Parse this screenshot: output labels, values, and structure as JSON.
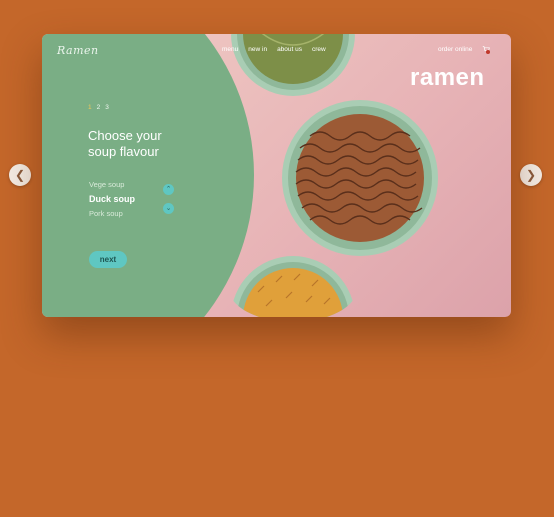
{
  "logo": "Ramen",
  "nav": {
    "items": [
      "menu",
      "new in",
      "about us",
      "crew"
    ]
  },
  "order": "order online",
  "brand": "ramen",
  "steps": {
    "items": [
      "1",
      "2",
      "3"
    ],
    "active": "1"
  },
  "headline": {
    "line1": "Choose your",
    "line2": "soup flavour"
  },
  "soups": {
    "items": [
      "Vege soup",
      "Duck soup",
      "Pork soup"
    ],
    "selected": "Duck soup"
  },
  "next_label": "next",
  "colors": {
    "background": "#c4672a",
    "green_panel": "#7aae85",
    "accent": "#5fc7c2",
    "step_active": "#f1c85a",
    "bowl_rim": "#a9cdb4",
    "soup_vege": "#7d8f48",
    "soup_duck": "#9c5a35",
    "soup_pork": "#e0a03a"
  },
  "icons": {
    "prev": "chevron-left-icon",
    "next": "chevron-right-icon",
    "cart": "cart-icon"
  }
}
